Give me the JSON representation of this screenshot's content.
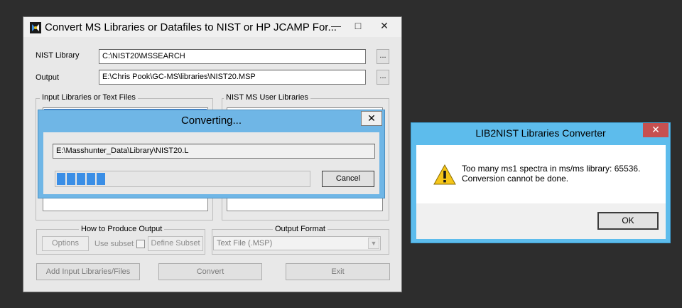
{
  "main_window": {
    "title": "Convert MS Libraries or Datafiles to NIST or HP JCAMP For...",
    "minimize_glyph": "—",
    "maximize_glyph": "□",
    "close_glyph": "✕",
    "nist_library_label": "NIST Library",
    "nist_library_value": "C:\\NIST20\\MSSEARCH",
    "output_label": "Output",
    "output_value": "E:\\Chris Pook\\GC-MS\\libraries\\NIST20.MSP",
    "browse_label": "...",
    "input_group_title": "Input Libraries or Text Files",
    "user_libs_group_title": "NIST MS User Libraries",
    "how_group_title": "How to Produce Output",
    "options_button": "Options",
    "use_subset_label": "Use subset",
    "define_subset_button": "Define Subset",
    "output_format_group_title": "Output Format",
    "output_format_value": "Text File (.MSP)",
    "add_button": "Add Input Libraries/Files",
    "convert_button": "Convert",
    "exit_button": "Exit"
  },
  "converting_dialog": {
    "title": "Converting...",
    "close_glyph": "✕",
    "file_path": "E:\\Masshunter_Data\\Library\\NIST20.L",
    "progress_segments": 5,
    "cancel_button": "Cancel"
  },
  "lib2nist_dialog": {
    "title": "LIB2NIST Libraries Converter",
    "close_glyph": "✕",
    "message_line1": "Too many ms1 spectra in ms/ms library: 65536.",
    "message_line2": "Conversion cannot be done.",
    "ok_button": "OK"
  },
  "colors": {
    "desktop": "#2d2d2d",
    "dialog_border_blue": "#6fb6e6",
    "progress_blue": "#3a8ee6",
    "close_red": "#c75050",
    "warning_yellow": "#f5c518"
  }
}
